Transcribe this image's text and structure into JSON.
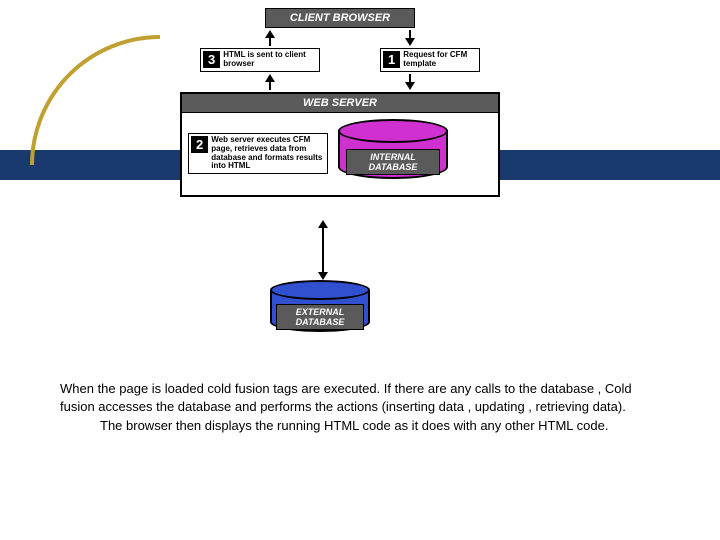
{
  "diagram": {
    "client_header": "CLIENT BROWSER",
    "web_server_header": "WEB SERVER",
    "steps": {
      "1": {
        "num": "1",
        "text": "Request for CFM template"
      },
      "2": {
        "num": "2",
        "text": "Web server executes CFM page, retrieves data from database and formats results into HTML"
      },
      "3": {
        "num": "3",
        "text": "HTML is sent to client browser"
      }
    },
    "internal_db": "INTERNAL DATABASE",
    "external_db": "EXTERNAL DATABASE"
  },
  "body_text": {
    "p1": "When the page is loaded cold fusion tags are executed. If there are any calls to the database , Cold fusion accesses the database and performs the actions (inserting data , updating , retrieving data).",
    "p2": "The browser then displays the running HTML code as it does with any other HTML code."
  }
}
